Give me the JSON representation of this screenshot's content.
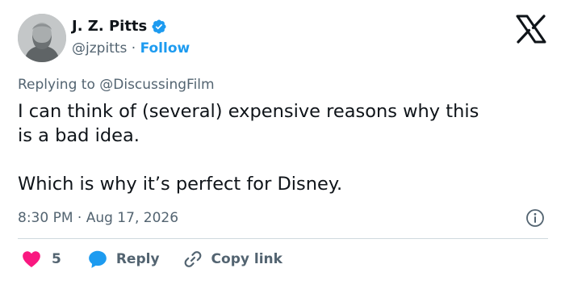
{
  "author": {
    "name": "J. Z. Pitts",
    "handle": "@jzpitts",
    "separator": "·",
    "follow_label": "Follow"
  },
  "reply_context": {
    "prefix": "Replying to",
    "mention": "@DiscussingFilm"
  },
  "tweet": {
    "text": "I can think of (several) expensive reasons why this\nis a bad idea.\n\nWhich is why it’s perfect for Disney."
  },
  "meta": {
    "timestamp": "8:30 PM · Aug 17, 2026"
  },
  "actions": {
    "like_count": "5",
    "reply_label": "Reply",
    "copy_label": "Copy link"
  },
  "colors": {
    "like": "#f91880",
    "reply": "#1d9bf0",
    "follow": "#1d9bf0",
    "muted": "#536471"
  },
  "icons": [
    "avatar",
    "verified-badge-icon",
    "x-logo-icon",
    "info-icon",
    "heart-icon",
    "reply-bubble-icon",
    "link-icon"
  ]
}
